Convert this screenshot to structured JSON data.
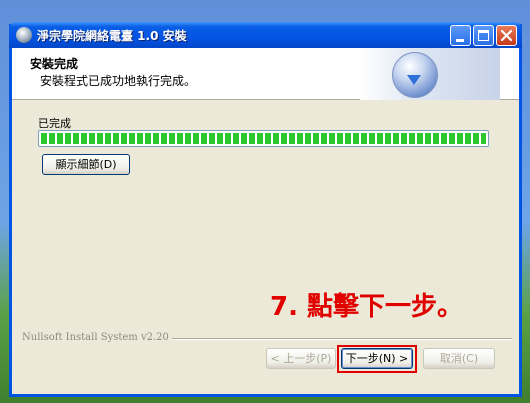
{
  "window": {
    "title": "淨宗學院網絡電臺 1.0 安裝"
  },
  "header": {
    "title": "安裝完成",
    "subtitle": "安裝程式已成功地執行完成。"
  },
  "content": {
    "status_label": "已完成",
    "progress_fraction": 1.0,
    "details_button": "顯示細節(D)"
  },
  "footer": {
    "brand": "Nullsoft Install System v2.20",
    "back_button": "< 上一步(P)",
    "next_button": "下一步(N) >",
    "cancel_button": "取消(C)"
  },
  "annotation": {
    "text": "7. 點擊下一步。",
    "color": "#e00000"
  },
  "colors": {
    "titlebar": "#0454e3",
    "progress": "#2ec82e",
    "highlight": "#e00000"
  }
}
